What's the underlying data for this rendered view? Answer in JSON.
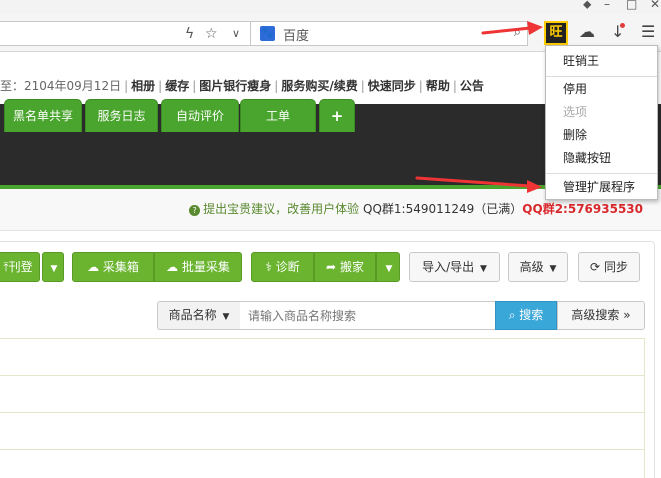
{
  "browser": {
    "window_controls": {
      "minimize": "–",
      "maximize": "□",
      "close": "✕",
      "other": "⬥"
    },
    "search_engine": "百度",
    "extension_icon_text": "旺"
  },
  "topnav": {
    "prefix": "至：2104年09月12日",
    "links": [
      "相册",
      "缓存",
      "图片银行瘦身",
      "服务购买/续费",
      "快速同步",
      "帮助",
      "公告"
    ]
  },
  "tabs": [
    "黑名单共享",
    "服务日志",
    "自动评价",
    "工单",
    "+"
  ],
  "notice": {
    "tip": "提出宝贵建议，改善用户体验",
    "qq1": "QQ群1:549011249（已满）",
    "qq2": "QQ群2:576935530"
  },
  "action_buttons": {
    "publish": "刊登",
    "collect_box": "采集箱",
    "batch_collect": "批量采集",
    "diagnose": "诊断",
    "move": "搬家",
    "import_export": "导入/导出",
    "advanced": "高级",
    "sync": "同步"
  },
  "filter": {
    "field_select": "商品名称",
    "placeholder": "请输入商品名称搜索",
    "search_button": "搜索",
    "advanced_search": "高级搜索"
  },
  "extension_menu": {
    "items": [
      {
        "label": "旺销王",
        "enabled": true
      },
      {
        "label": "停用",
        "enabled": true
      },
      {
        "label": "选项",
        "enabled": false
      },
      {
        "label": "删除",
        "enabled": true
      },
      {
        "label": "隐藏按钮",
        "enabled": true
      },
      {
        "label": "管理扩展程序",
        "enabled": true
      }
    ]
  },
  "colors": {
    "accent_green": "#4aa52e",
    "button_green": "#6ab42f",
    "search_blue": "#3aa7d9",
    "highlight_red": "#d9282c",
    "arrow_red": "#ee3434",
    "extension_badge": "#ffcc00"
  }
}
